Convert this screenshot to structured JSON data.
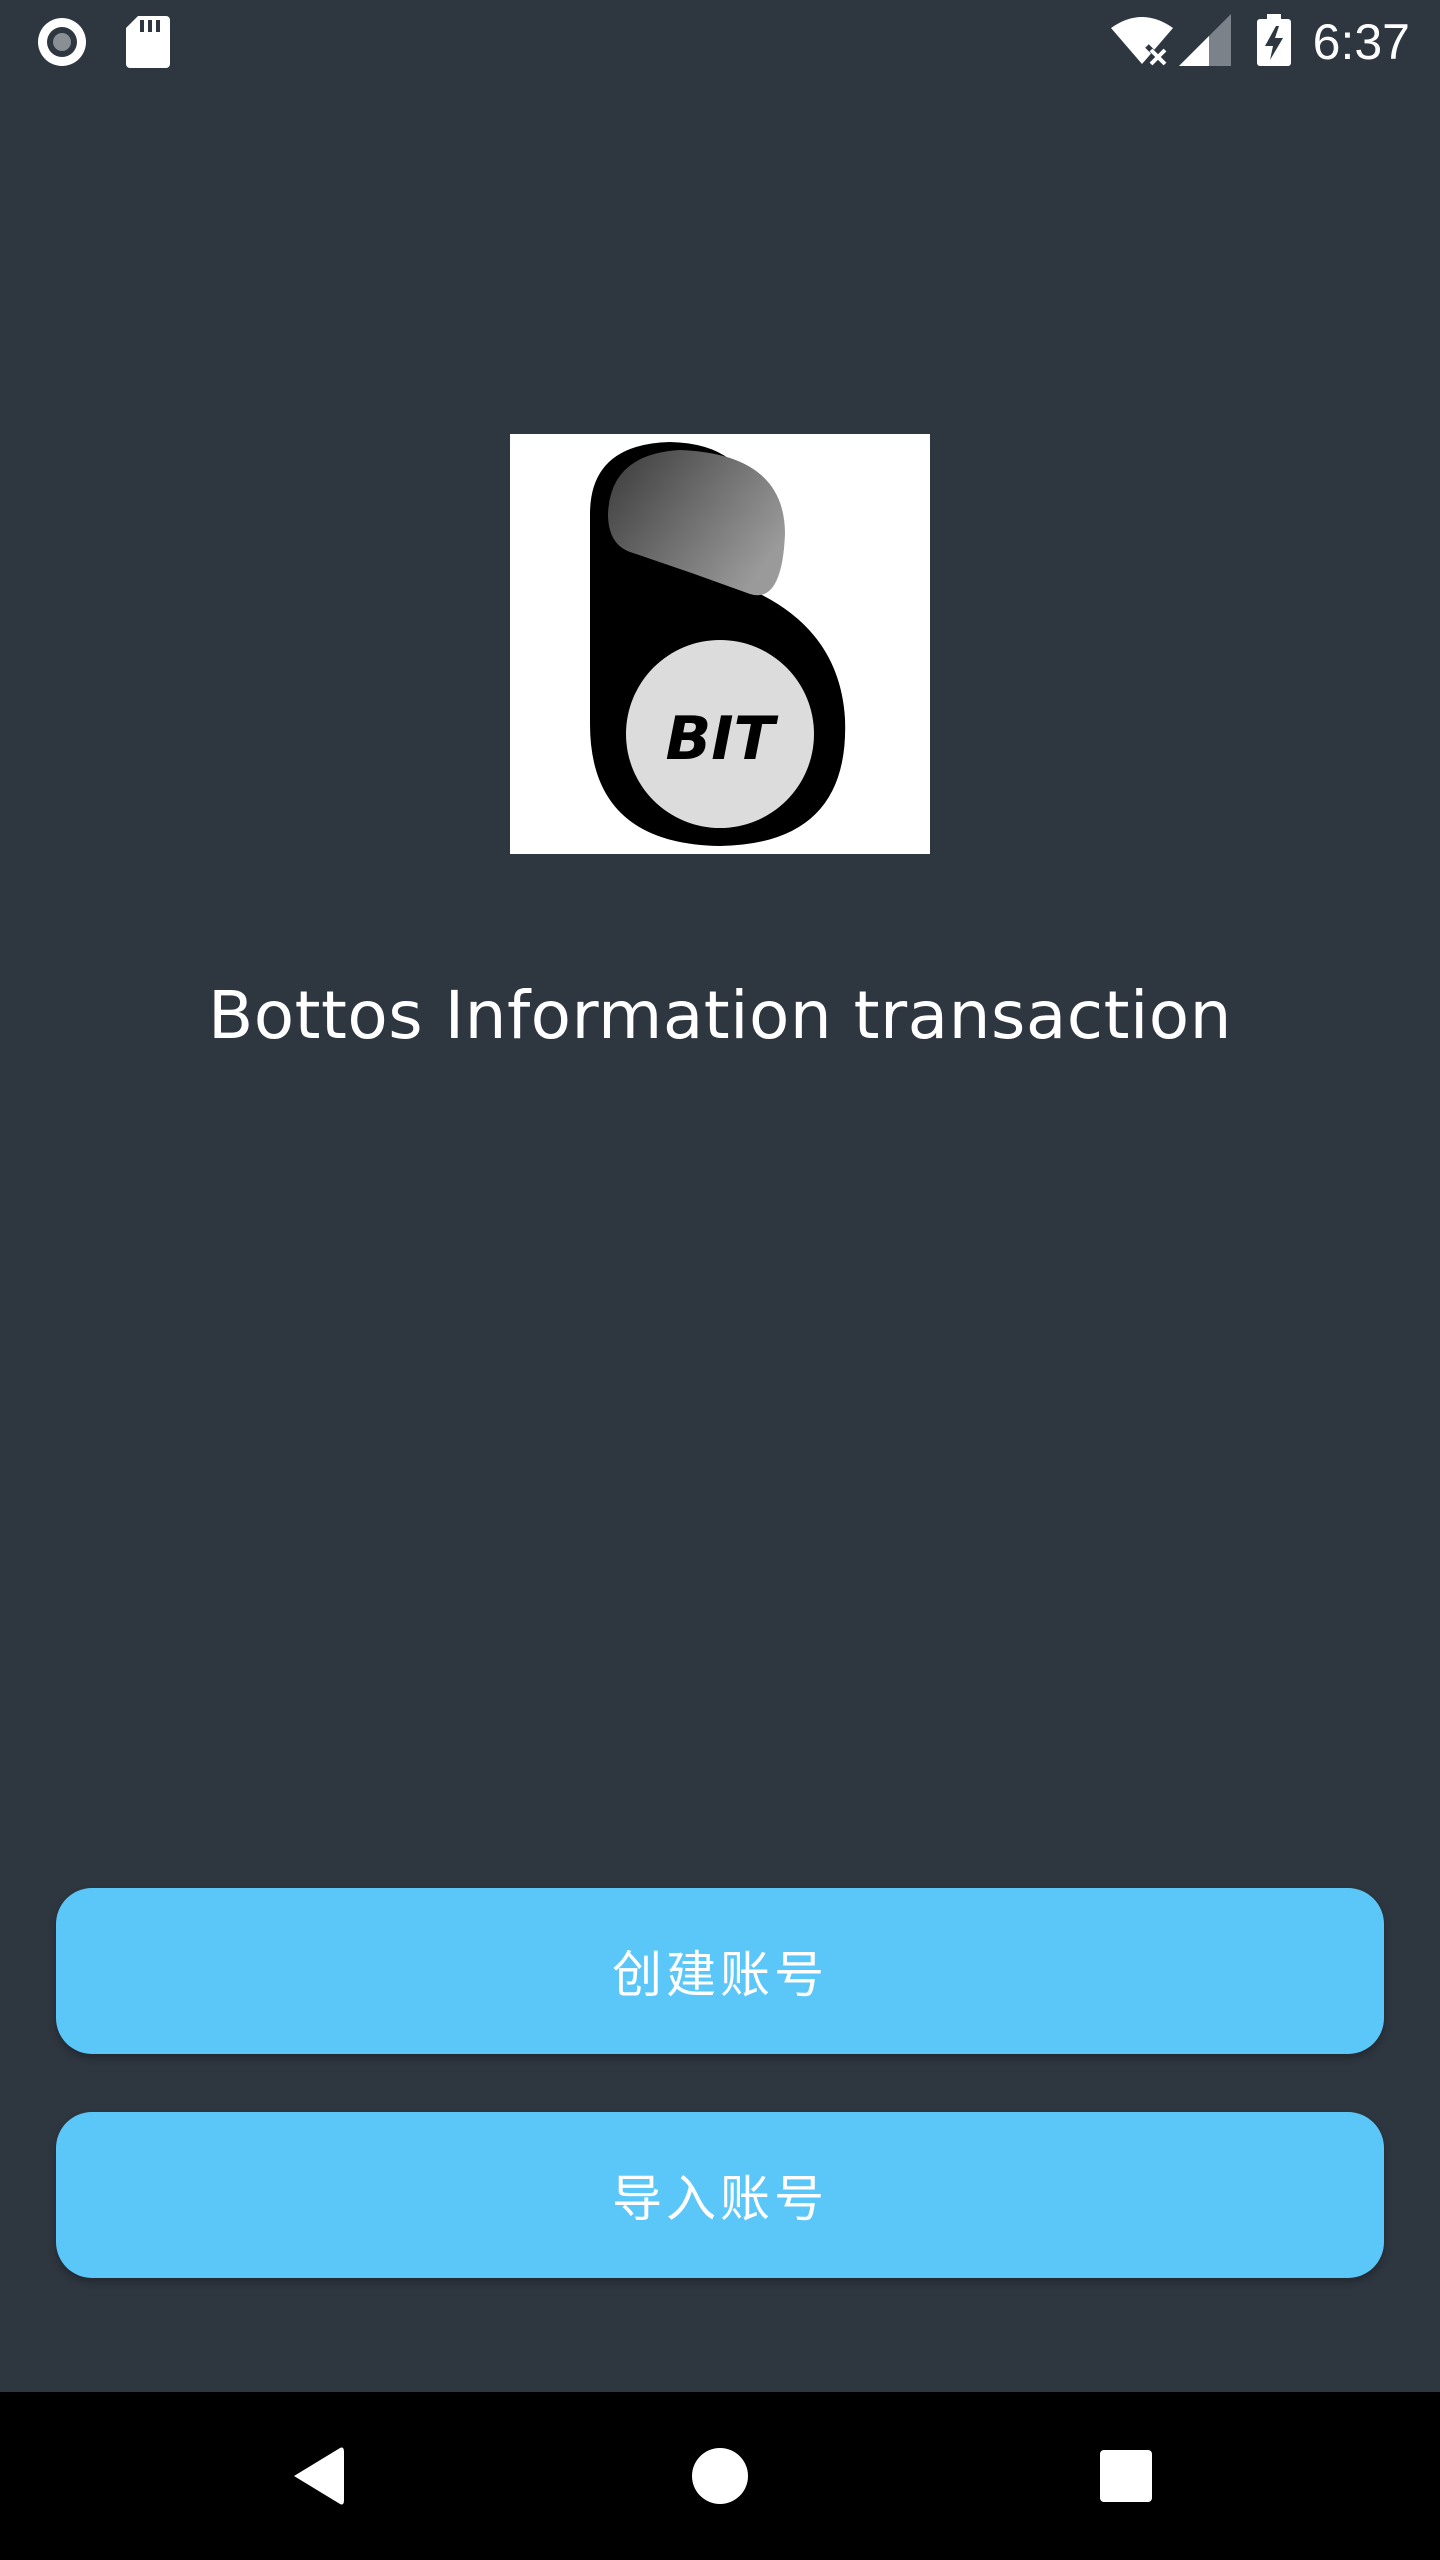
{
  "status_bar": {
    "time": "6:37",
    "icons": [
      "record-icon",
      "sd-card-icon",
      "wifi-no-internet-icon",
      "cell-signal-icon",
      "battery-charging-icon"
    ]
  },
  "logo": {
    "icon": "bit-logo-icon",
    "text": "BIT"
  },
  "app": {
    "title": "Bottos Information transaction"
  },
  "buttons": {
    "create_account": "创建账号",
    "import_account": "导入账号"
  },
  "colors": {
    "background": "#2e3640",
    "button": "#5bc7f8",
    "nav_bar": "#000000"
  },
  "nav_bar": {
    "icons": [
      "back-icon",
      "home-icon",
      "recents-icon"
    ]
  }
}
